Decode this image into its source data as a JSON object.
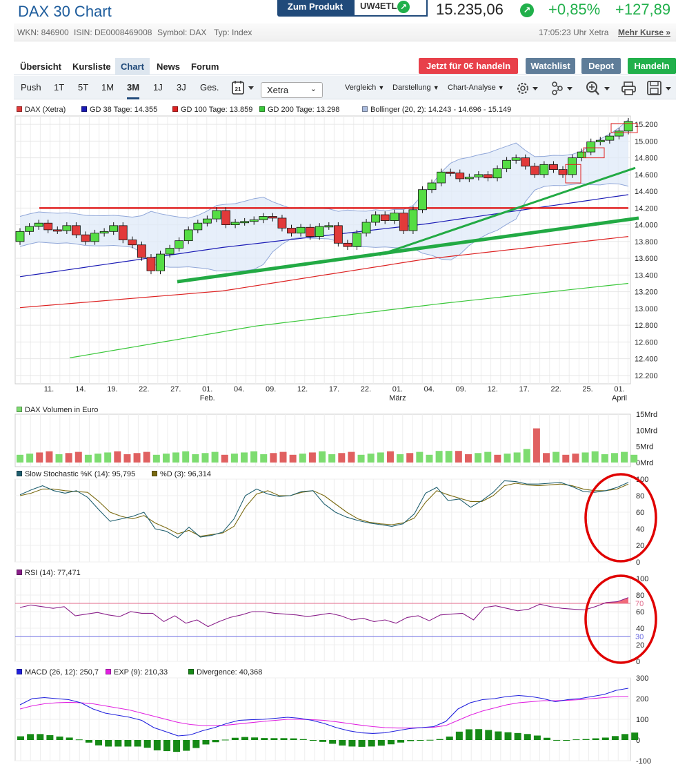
{
  "header": {
    "title": "DAX 30 Chart",
    "zum_produkt": "Zum Produkt",
    "ticker": "UW4ETL",
    "price": "15.235,06",
    "change_pct": "+0,85%",
    "change_abs": "+127,89"
  },
  "info": {
    "wkn": "WKN: 846900",
    "isin": "ISIN: DE0008469008",
    "symbol": "Symbol: DAX",
    "typ": "Typ: Index",
    "time": "17:05:23 Uhr Xetra",
    "mehr": "Mehr Kurse »"
  },
  "tabs": [
    "Übersicht",
    "Kursliste",
    "Chart",
    "News",
    "Forum"
  ],
  "actions": {
    "trade0": "Jetzt für 0€ handeln",
    "watchlist": "Watchlist",
    "depot": "Depot",
    "handeln": "Handeln"
  },
  "toolbar": {
    "ranges": [
      "Push",
      "1T",
      "5T",
      "1M",
      "3M",
      "1J",
      "3J",
      "Ges."
    ],
    "active_range": "3M",
    "calendar_day": "21",
    "exchange": "Xetra",
    "vergleich": "Vergleich",
    "darstellung": "Darstellung",
    "analyse": "Chart-Analyse"
  },
  "legend": {
    "main": [
      {
        "label": "DAX (Xetra)",
        "color": "#e03a3a"
      },
      {
        "label": "GD 38 Tage: 14.355",
        "color": "#1a1ab5"
      },
      {
        "label": "GD 100 Tage: 13.859",
        "color": "#dd2222"
      },
      {
        "label": "GD 200 Tage: 13.298",
        "color": "#3ac73a"
      },
      {
        "label": "Bollinger (20, 2): 14.243 - 14.696 - 15.149",
        "color": "#aabbdd"
      }
    ],
    "volume": "DAX Volumen in Euro",
    "stoch_k": "Slow Stochastic %K (14): 95,795",
    "stoch_d": "%D (3): 96,314",
    "rsi": "RSI (14): 77,471",
    "macd": "MACD (26, 12): 250,7",
    "exp": "EXP (9): 210,33",
    "divergence": "Divergence: 40,368"
  },
  "chart_data": [
    {
      "type": "candlestick",
      "title": "DAX 30 Chart",
      "ylim": [
        12100,
        15300
      ],
      "y_ticks": [
        "15.200",
        "15.000",
        "14.800",
        "14.600",
        "14.400",
        "14.200",
        "14.000",
        "13.800",
        "13.600",
        "13.400",
        "13.200",
        "13.000",
        "12.800",
        "12.600",
        "12.400",
        "12.200"
      ],
      "x_ticks": [
        {
          "day": "11.",
          "month": ""
        },
        {
          "day": "14.",
          "month": ""
        },
        {
          "day": "19.",
          "month": ""
        },
        {
          "day": "22.",
          "month": ""
        },
        {
          "day": "27.",
          "month": ""
        },
        {
          "day": "01.",
          "month": "Feb."
        },
        {
          "day": "04.",
          "month": ""
        },
        {
          "day": "09.",
          "month": ""
        },
        {
          "day": "12.",
          "month": ""
        },
        {
          "day": "17.",
          "month": ""
        },
        {
          "day": "22.",
          "month": ""
        },
        {
          "day": "01.",
          "month": "März"
        },
        {
          "day": "04.",
          "month": ""
        },
        {
          "day": "09.",
          "month": ""
        },
        {
          "day": "12.",
          "month": ""
        },
        {
          "day": "17.",
          "month": ""
        },
        {
          "day": "22.",
          "month": ""
        },
        {
          "day": "25.",
          "month": ""
        },
        {
          "day": "01.",
          "month": "April"
        }
      ],
      "candles_close": [
        13920,
        13980,
        14020,
        13940,
        13930,
        13990,
        13880,
        13800,
        13900,
        13920,
        13990,
        13820,
        13760,
        13610,
        13450,
        13650,
        13720,
        13810,
        13940,
        14020,
        14070,
        14170,
        14000,
        14030,
        14040,
        14060,
        14100,
        14080,
        13960,
        13900,
        13970,
        13860,
        13980,
        13990,
        13780,
        13740,
        13900,
        14030,
        14120,
        14050,
        14140,
        13930,
        14180,
        14420,
        14500,
        14630,
        14620,
        14550,
        14570,
        14600,
        14560,
        14670,
        14770,
        14800,
        14700,
        14600,
        14720,
        14660,
        14600,
        14800,
        14870,
        14990,
        15010,
        15060,
        15120,
        15235
      ],
      "gd38": [
        13380,
        13730,
        14010,
        14360
      ],
      "gd100": [
        13010,
        13210,
        13590,
        13860
      ],
      "gd200": [
        12410,
        12790,
        13060,
        13300
      ],
      "bollinger_upper_end": 15149,
      "bollinger_lower_end": 14243,
      "annotation_resistance": 14200
    },
    {
      "type": "bar",
      "title": "DAX Volumen in Euro",
      "y_ticks": [
        "15Mrd",
        "10Mrd",
        "5Mrd",
        "0Mrd"
      ],
      "ylim": [
        0,
        15
      ]
    },
    {
      "type": "line",
      "title": "Slow Stochastic",
      "series": [
        {
          "name": "%K",
          "last": 95.795,
          "color": "#1f5f6f"
        },
        {
          "name": "%D",
          "last": 96.314,
          "color": "#7a6a10"
        }
      ],
      "k_values": [
        81,
        87,
        92,
        86,
        83,
        86,
        78,
        63,
        49,
        52,
        55,
        60,
        40,
        37,
        29,
        42,
        30,
        32,
        36,
        52,
        80,
        88,
        82,
        79,
        80,
        85,
        86,
        70,
        60,
        54,
        50,
        47,
        45,
        43,
        46,
        58,
        83,
        90,
        74,
        76,
        66,
        74,
        84,
        98,
        97,
        94,
        94,
        95,
        96,
        91,
        85,
        84,
        86,
        90,
        96
      ],
      "d_values": [
        80,
        83,
        88,
        88,
        86,
        85,
        84,
        73,
        60,
        55,
        52,
        56,
        47,
        41,
        34,
        38,
        31,
        33,
        35,
        43,
        66,
        82,
        86,
        80,
        80,
        84,
        86,
        80,
        70,
        60,
        52,
        48,
        46,
        45,
        47,
        53,
        72,
        86,
        81,
        77,
        73,
        73,
        80,
        92,
        95,
        93,
        92,
        93,
        94,
        92,
        88,
        86,
        86,
        88,
        94
      ],
      "y_ticks": [
        "100",
        "80",
        "60",
        "40",
        "20",
        "0"
      ],
      "ylim": [
        0,
        100
      ]
    },
    {
      "type": "line",
      "title": "RSI",
      "series": [
        {
          "name": "RSI (14)",
          "last": 77.471,
          "color": "#8a1f8a"
        }
      ],
      "values": [
        65,
        68,
        66,
        64,
        66,
        55,
        57,
        59,
        56,
        54,
        60,
        58,
        58,
        48,
        55,
        46,
        50,
        42,
        48,
        53,
        56,
        60,
        60,
        58,
        57,
        56,
        54,
        56,
        58,
        55,
        50,
        52,
        48,
        50,
        46,
        53,
        55,
        49,
        56,
        57,
        58,
        50,
        65,
        67,
        64,
        61,
        63,
        69,
        66,
        64,
        63,
        62,
        66,
        71,
        72,
        77
      ],
      "reference_lines": [
        70,
        30
      ],
      "y_ticks": [
        "100",
        "80",
        "60",
        "40",
        "20",
        "0"
      ],
      "ylim": [
        0,
        100
      ]
    },
    {
      "type": "line",
      "title": "MACD",
      "series": [
        {
          "name": "MACD (26, 12)",
          "last": 250.7,
          "color": "#2020dd"
        },
        {
          "name": "EXP (9)",
          "last": 210.33,
          "color": "#e020e0"
        },
        {
          "name": "Divergence",
          "last": 40.368,
          "color": "#168a16"
        }
      ],
      "macd_values": [
        170,
        200,
        205,
        200,
        195,
        180,
        150,
        130,
        120,
        110,
        95,
        60,
        40,
        20,
        25,
        45,
        60,
        80,
        95,
        98,
        100,
        105,
        110,
        105,
        95,
        80,
        60,
        45,
        35,
        32,
        35,
        45,
        55,
        60,
        65,
        90,
        150,
        180,
        195,
        200,
        210,
        215,
        210,
        200,
        185,
        195,
        200,
        210,
        220,
        240,
        250
      ],
      "exp_values": [
        150,
        165,
        175,
        180,
        182,
        180,
        175,
        165,
        155,
        145,
        130,
        115,
        100,
        85,
        75,
        70,
        70,
        72,
        78,
        84,
        90,
        95,
        100,
        100,
        98,
        95,
        88,
        80,
        72,
        65,
        60,
        58,
        58,
        60,
        62,
        70,
        95,
        120,
        140,
        155,
        170,
        180,
        185,
        190,
        190,
        192,
        195,
        200,
        205,
        210,
        210
      ],
      "y_ticks": [
        "300",
        "200",
        "100",
        "0",
        "-100"
      ],
      "ylim": [
        -100,
        300
      ]
    }
  ]
}
